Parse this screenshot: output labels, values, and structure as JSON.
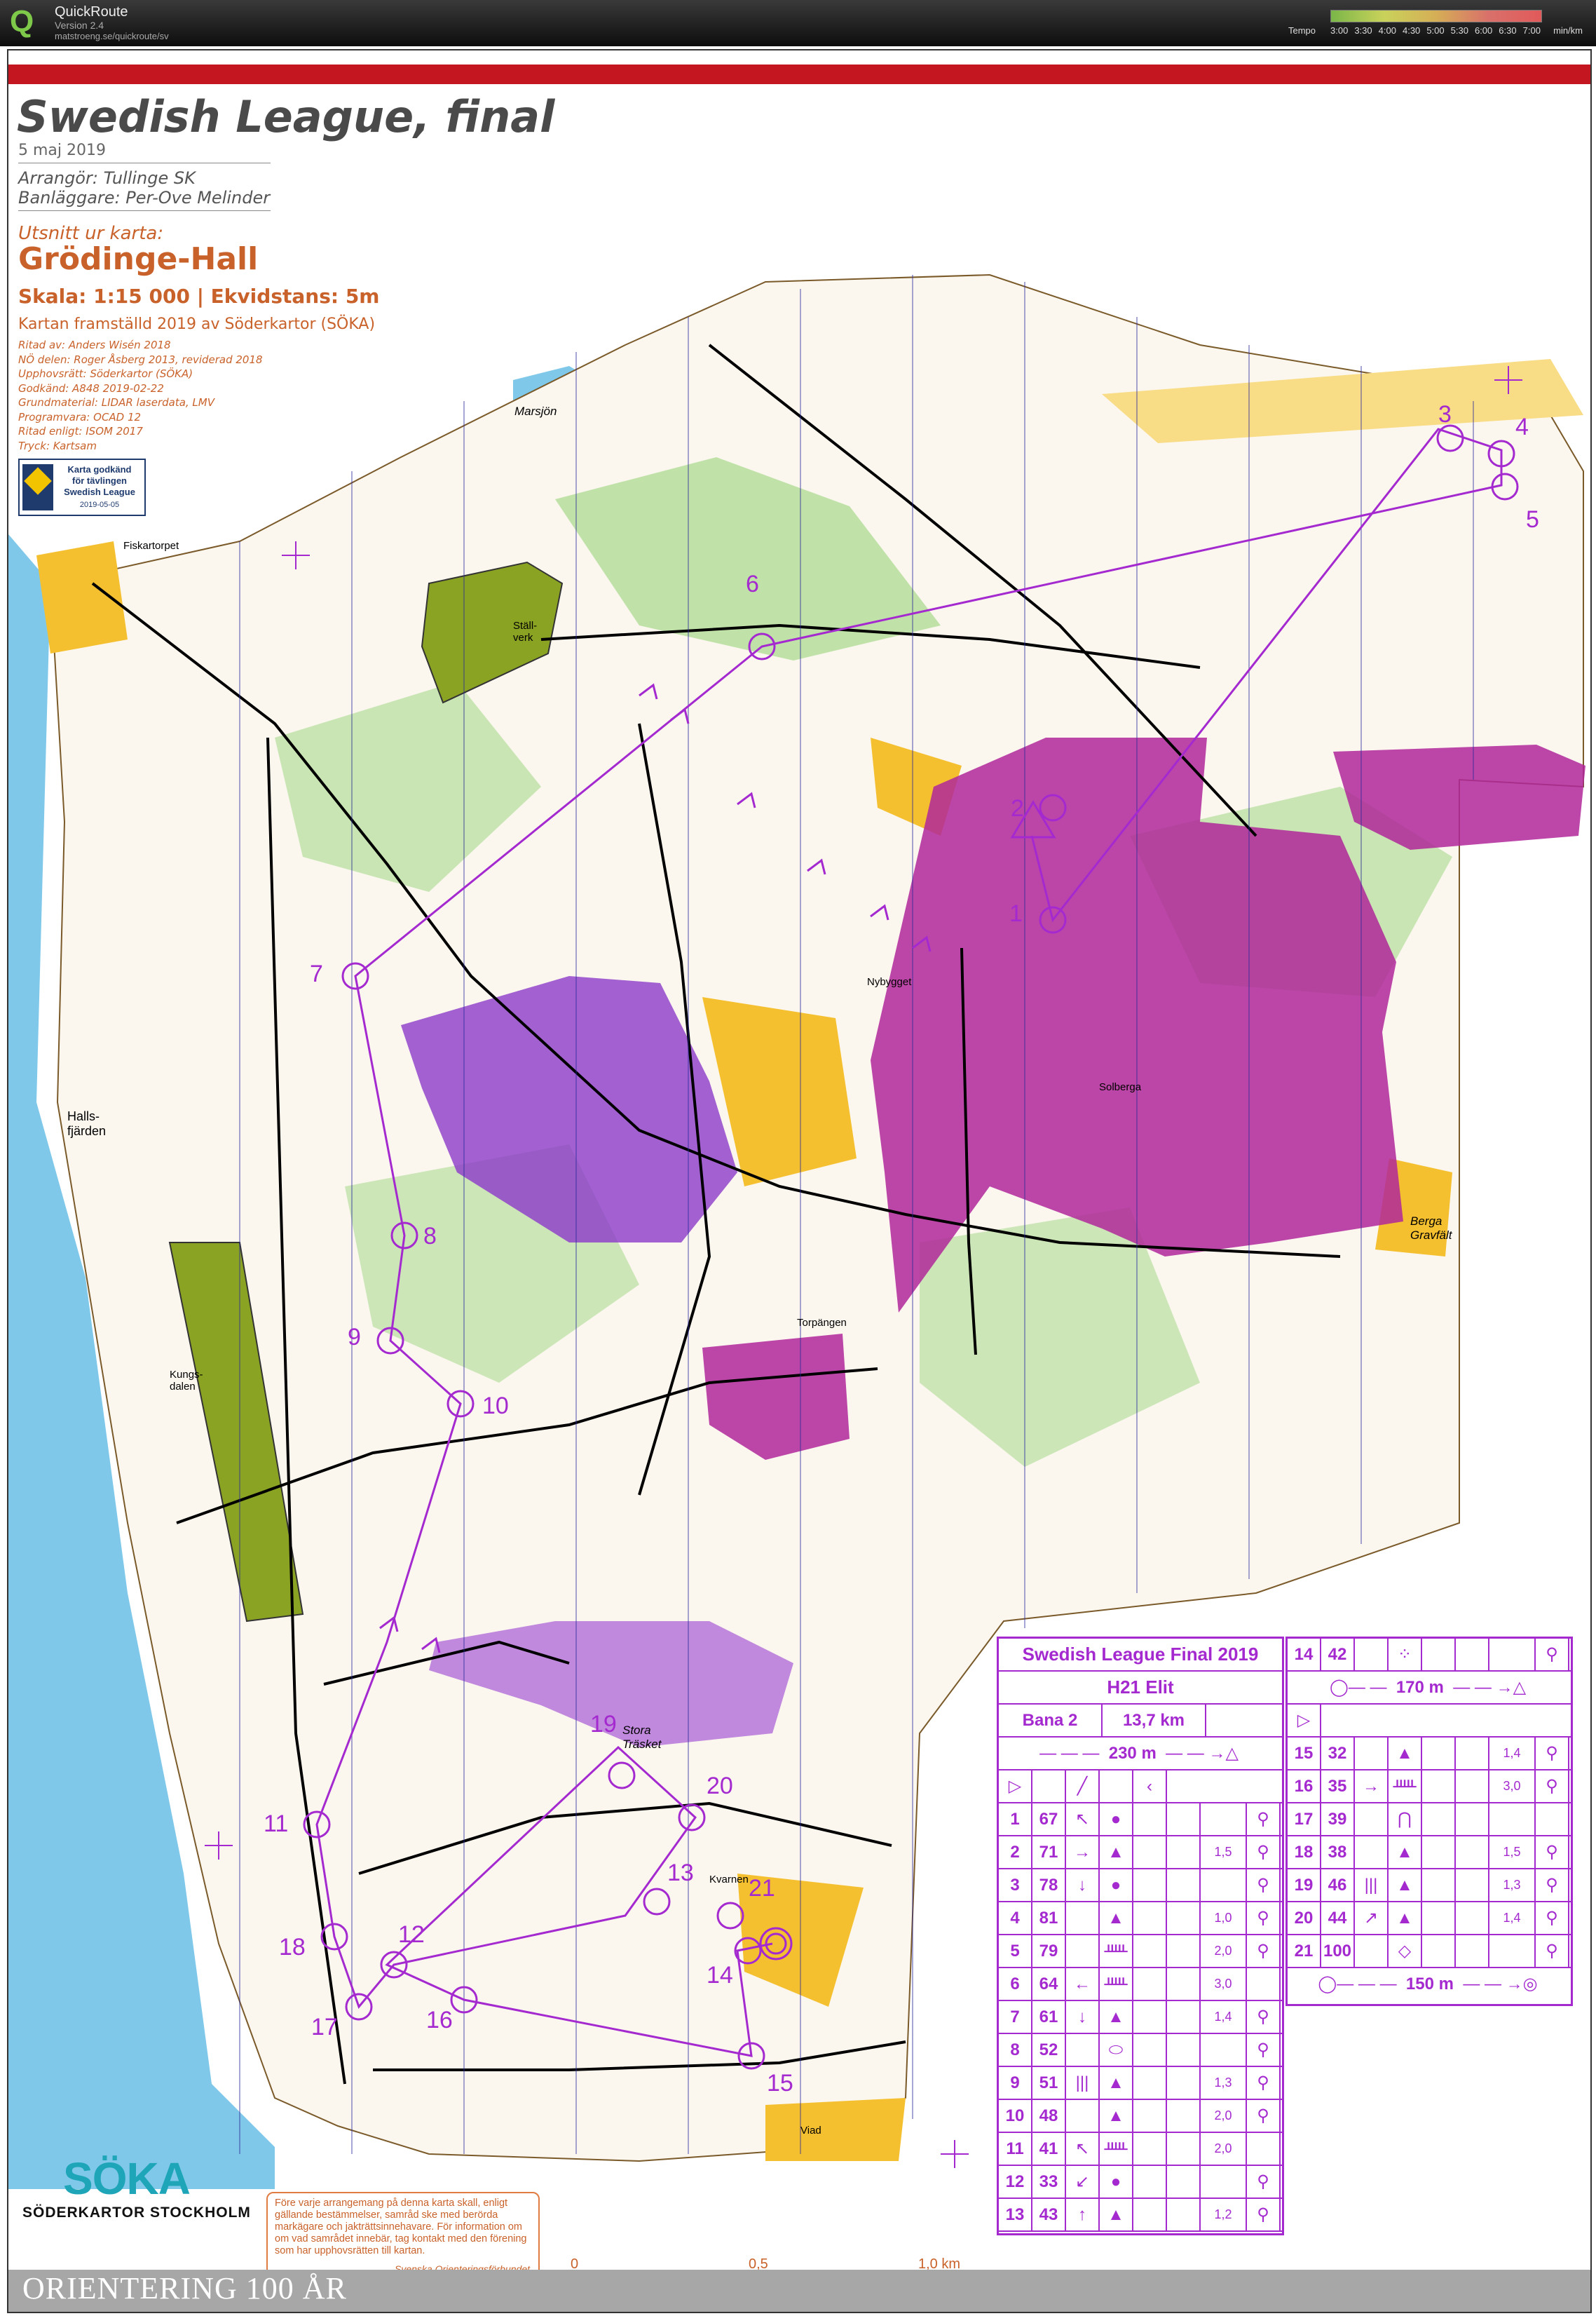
{
  "app": {
    "name": "QuickRoute",
    "version": "Version 2.4",
    "url": "matstroeng.se/quickroute/sv",
    "tempo_label": "Tempo",
    "tempo_ticks": [
      "3:00",
      "3:30",
      "4:00",
      "4:30",
      "5:00",
      "5:30",
      "6:00",
      "6:30",
      "7:00"
    ],
    "tempo_unit": "min/km"
  },
  "map": {
    "title": "Swedish League, final",
    "date": "5 maj 2019",
    "organizer": "Arrangör: Tullinge SK",
    "course_setter": "Banläggare: Per-Ove Melinder",
    "excerpt_label": "Utsnitt ur karta:",
    "map_name": "Grödinge-Hall",
    "scale_line": "Skala: 1:15 000 | Ekvidstans: 5m",
    "produced": "Kartan framställd 2019 av Söderkartor (SÖKA)",
    "credits": [
      "Ritad av: Anders Wisén  2018",
      "NÖ delen: Roger Åsberg 2013, reviderad 2018",
      "Upphovsrätt: Söderkartor (SÖKA)",
      "Godkänd: A848 2019-02-22",
      "Grundmaterial: LIDAR laserdata, LMV",
      "Programvara: OCAD 12",
      "Ritad enligt: ISOM 2017",
      "Tryck: Kartsam"
    ],
    "approval": {
      "line1": "Karta godkänd",
      "line2": "för tävlingen",
      "line3": "Swedish League",
      "date": "2019-05-05"
    },
    "place_names": {
      "marsjon": "Marsjön",
      "fiskartorpet": "Fiskartorpet",
      "stallverk": "Ställ-\nverk",
      "hallsfjarden": "Halls-\nfjärden",
      "kungsdalen": "Kungs-\ndalen",
      "nybygget": "Nybygget",
      "solberga": "Solberga",
      "berga_gravfalt": "Berga\nGravfält",
      "torpangen": "Torpängen",
      "stora_trasket": "Stora\nTräsket",
      "kvarnen": "Kvarnen",
      "viad": "Viad"
    },
    "bottom_banner": "ORIENTERING 100 ÅR",
    "soka_word": "SÖKA",
    "soka_sub": "SÖDERKARTOR  STOCKHOLM",
    "notice": "Före varje arrangemang på denna karta skall, enligt gällande bestämmelser, samråd ske med berörda markägare och jakträttsinnehavare. För information om om vad samrådet innebär, tag kontakt med den förening som har upphovsrätten till kartan.",
    "notice_signature": "Svenska Orienteringsförbundet",
    "scalebar": {
      "start": "0",
      "mid": "0,5",
      "end": "1,0 km"
    },
    "colors": {
      "course": "#a42ad0",
      "red_band": "#c41620",
      "orange_text": "#c9622a",
      "olive": "#8aa323",
      "water": "#7fc8ea"
    }
  },
  "course": {
    "controls": [
      {
        "n": "1",
        "code": "67",
        "feature": "↖",
        "appearance": "●",
        "dim": "",
        "loc": "⚲"
      },
      {
        "n": "2",
        "code": "71",
        "feature": "→",
        "appearance": "▲",
        "dim": "1,5",
        "loc": "⚲"
      },
      {
        "n": "3",
        "code": "78",
        "feature": "↓",
        "appearance": "●",
        "dim": "",
        "loc": "⚲"
      },
      {
        "n": "4",
        "code": "81",
        "feature": "",
        "appearance": "▲",
        "dim": "1,0",
        "loc": "⚲"
      },
      {
        "n": "5",
        "code": "79",
        "feature": "",
        "appearance": "ᚊ",
        "dim": "2,0",
        "loc": "⚲"
      },
      {
        "n": "6",
        "code": "64",
        "feature": "←",
        "appearance": "ᚊ",
        "dim": "3,0",
        "loc": ""
      },
      {
        "n": "7",
        "code": "61",
        "feature": "↓",
        "appearance": "▲",
        "dim": "1,4",
        "loc": "⚲"
      },
      {
        "n": "8",
        "code": "52",
        "feature": "",
        "appearance": "⬭",
        "dim": "",
        "loc": "⚲"
      },
      {
        "n": "9",
        "code": "51",
        "feature": "|||",
        "appearance": "▲",
        "dim": "1,3",
        "loc": "⚲"
      },
      {
        "n": "10",
        "code": "48",
        "feature": "",
        "appearance": "▲",
        "dim": "2,0",
        "loc": "⚲"
      },
      {
        "n": "11",
        "code": "41",
        "feature": "↖",
        "appearance": "ᚊ",
        "dim": "2,0",
        "loc": ""
      },
      {
        "n": "12",
        "code": "33",
        "feature": "↙",
        "appearance": "●",
        "dim": "",
        "loc": "⚲"
      },
      {
        "n": "13",
        "code": "43",
        "feature": "↑",
        "appearance": "▲",
        "dim": "1,2",
        "loc": "⚲"
      },
      {
        "n": "14",
        "code": "42",
        "feature": "",
        "appearance": "⁘",
        "dim": "",
        "loc": "⚲"
      },
      {
        "n": "15",
        "code": "32",
        "feature": "",
        "appearance": "▲",
        "dim": "1,4",
        "loc": "⚲"
      },
      {
        "n": "16",
        "code": "35",
        "feature": "→",
        "appearance": "ᚊ",
        "dim": "3,0",
        "loc": "⚲"
      },
      {
        "n": "17",
        "code": "39",
        "feature": "",
        "appearance": "⋂",
        "dim": "",
        "loc": ""
      },
      {
        "n": "18",
        "code": "38",
        "feature": "",
        "appearance": "▲",
        "dim": "1,5",
        "loc": "⚲"
      },
      {
        "n": "19",
        "code": "46",
        "feature": "|||",
        "appearance": "▲",
        "dim": "1,3",
        "loc": "⚲"
      },
      {
        "n": "20",
        "code": "44",
        "feature": "↗",
        "appearance": "▲",
        "dim": "1,4",
        "loc": "⚲"
      },
      {
        "n": "21",
        "code": "100",
        "feature": "",
        "appearance": "◇",
        "dim": "",
        "loc": "⚲"
      }
    ],
    "description_header": {
      "event": "Swedish League Final 2019",
      "class": "H21 Elit",
      "course": "Bana 2",
      "length": "13,7 km",
      "start_marked": "230 m",
      "marked_route_1": "170 m",
      "finish_marked": "150 m"
    }
  }
}
